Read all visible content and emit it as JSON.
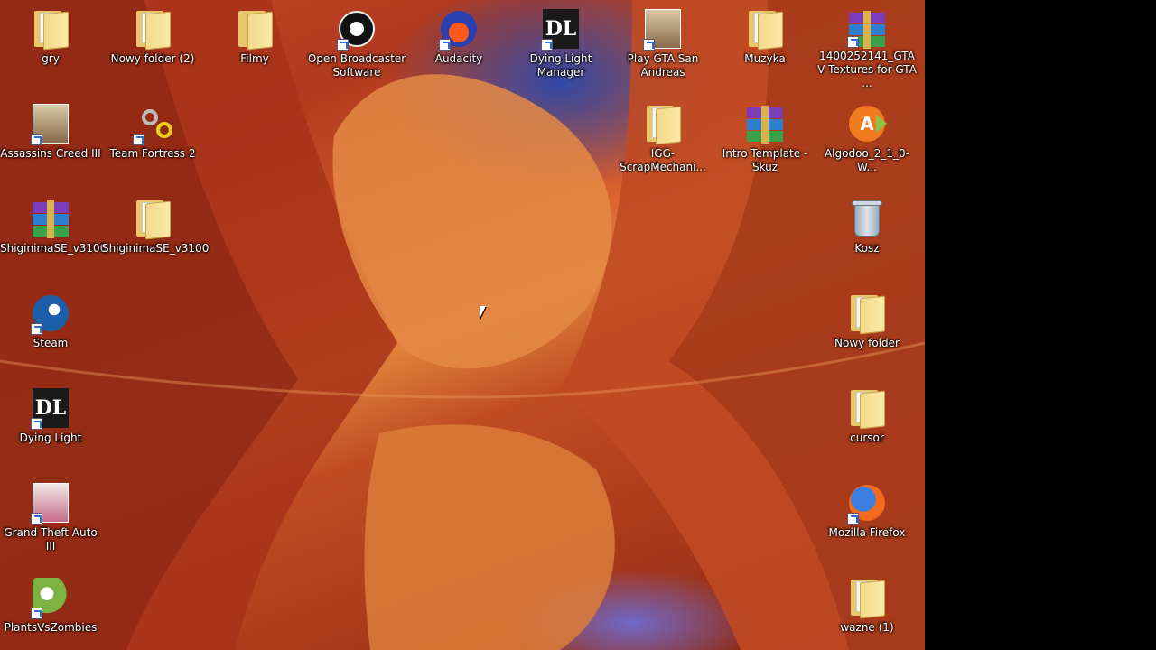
{
  "desktop": {
    "icons": [
      {
        "label": "gry",
        "icon": "folder-icon"
      },
      {
        "label": "Nowy folder (2)",
        "icon": "folder-icon"
      },
      {
        "label": "Filmy",
        "icon": "folder-icon"
      },
      {
        "label": "Open Broadcaster Software",
        "icon": "obs-icon"
      },
      {
        "label": "Audacity",
        "icon": "audacity-icon"
      },
      {
        "label": "Dying Light Manager",
        "icon": "dying-light-icon"
      },
      {
        "label": "Play GTA San Andreas",
        "icon": "gta-sa-icon"
      },
      {
        "label": "Muzyka",
        "icon": "folder-icon"
      },
      {
        "label": "1400252141_GTA V Textures for GTA ...",
        "icon": "archive-icon"
      },
      {
        "label": "Assassins Creed III",
        "icon": "assassins-creed-icon"
      },
      {
        "label": "Team Fortress 2",
        "icon": "tf2-icon"
      },
      {
        "label": "IGG-ScrapMechani...",
        "icon": "folder-icon"
      },
      {
        "label": "Intro Template - Skuz",
        "icon": "archive-icon"
      },
      {
        "label": "Algodoo_2_1_0-W...",
        "icon": "algodoo-icon"
      },
      {
        "label": "ShiginimaSE_v3100",
        "icon": "archive-icon"
      },
      {
        "label": "ShiginimaSE_v3100",
        "icon": "folder-icon"
      },
      {
        "label": "Kosz",
        "icon": "recycle-bin-icon"
      },
      {
        "label": "Steam",
        "icon": "steam-icon"
      },
      {
        "label": "Nowy folder",
        "icon": "folder-icon"
      },
      {
        "label": "Dying Light",
        "icon": "dying-light-icon"
      },
      {
        "label": "cursor",
        "icon": "folder-icon"
      },
      {
        "label": "Grand Theft Auto III",
        "icon": "gta3-icon"
      },
      {
        "label": "Mozilla Firefox",
        "icon": "firefox-icon"
      },
      {
        "label": "PlantsVsZombies",
        "icon": "pvz-icon"
      },
      {
        "label": "wazne (1)",
        "icon": "folder-icon"
      }
    ]
  }
}
